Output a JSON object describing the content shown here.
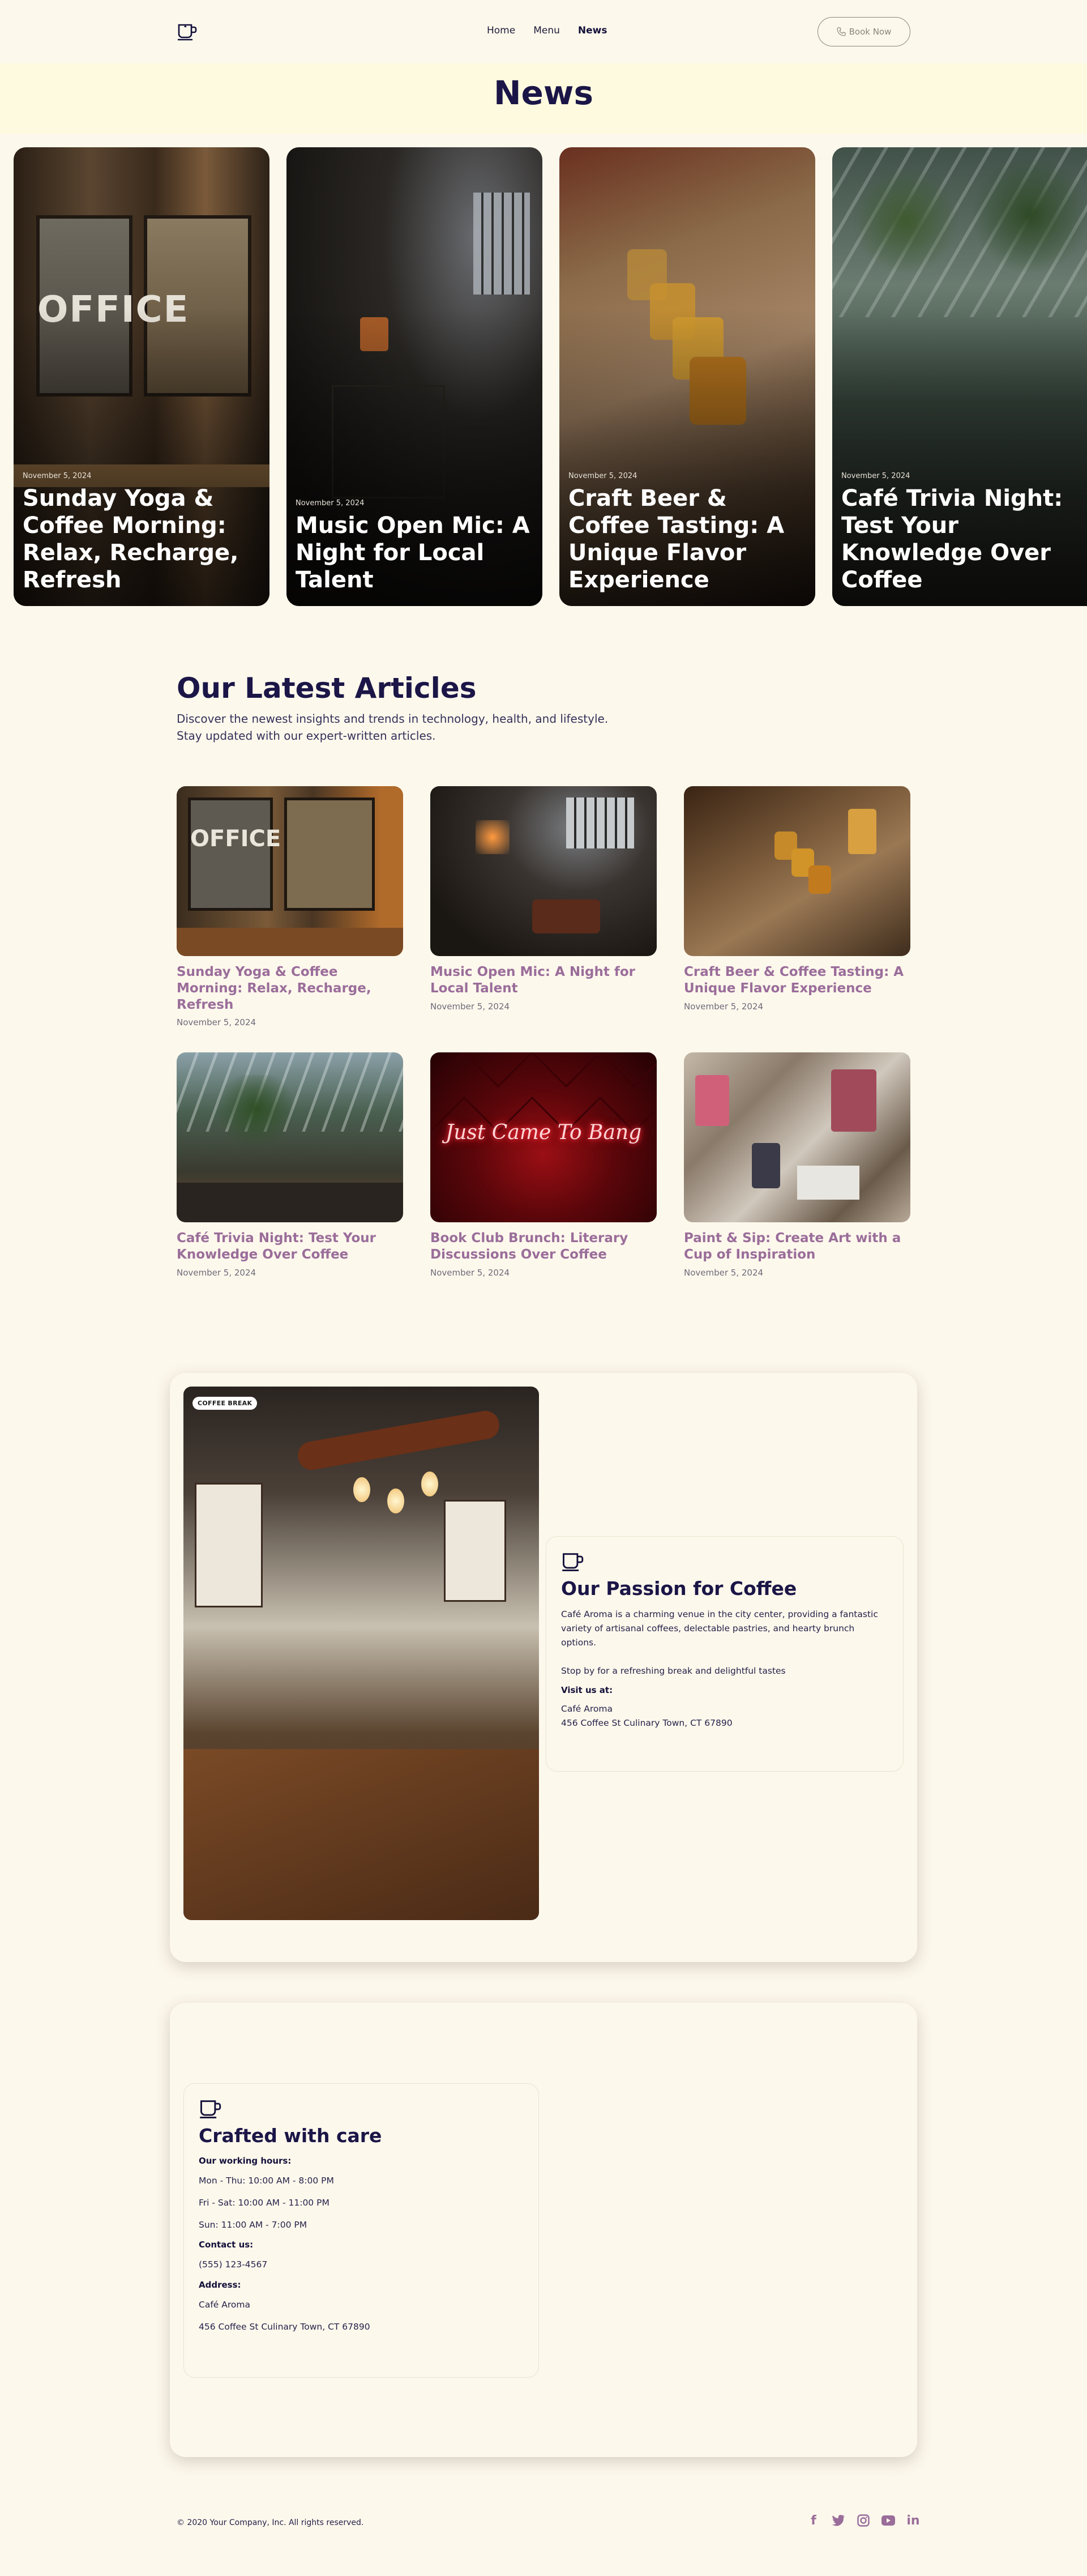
{
  "header": {
    "nav": [
      {
        "label": "Home"
      },
      {
        "label": "Menu"
      },
      {
        "label": "News"
      }
    ],
    "book_button": "Book Now",
    "logo_icon": "coffee-cup-icon"
  },
  "banner": {
    "title": "News"
  },
  "hero": [
    {
      "date": "November 5, 2024",
      "title": "Sunday Yoga & Coffee Morning: Relax, Recharge, Refresh"
    },
    {
      "date": "November 5, 2024",
      "title": "Music Open Mic: A Night for Local Talent"
    },
    {
      "date": "November 5, 2024",
      "title": "Craft Beer & Coffee Tasting: A Unique Flavor Experience"
    },
    {
      "date": "November 5, 2024",
      "title": "Café Trivia Night: Test Your Knowledge Over Coffee"
    }
  ],
  "latest": {
    "title": "Our Latest Articles",
    "subtitle": "Discover the newest insights and trends in technology, health, and lifestyle. Stay updated with our expert-written articles.",
    "articles": [
      {
        "title": "Sunday Yoga & Coffee Morning: Relax, Recharge, Refresh",
        "date": "November 5, 2024",
        "image_text": "OFFICE"
      },
      {
        "title": "Music Open Mic: A Night for Local Talent",
        "date": "November 5, 2024"
      },
      {
        "title": "Craft Beer & Coffee Tasting: A Unique Flavor Experience",
        "date": "November 5, 2024"
      },
      {
        "title": "Café Trivia Night: Test Your Knowledge Over Coffee",
        "date": "November 5, 2024"
      },
      {
        "title": "Book Club Brunch: Literary Discussions Over Coffee",
        "date": "November 5, 2024",
        "image_text": "Just Came To Bang"
      },
      {
        "title": "Paint & Sip: Create Art with a Cup of Inspiration",
        "date": "November 5, 2024"
      }
    ]
  },
  "about": {
    "badge": "COFFEE BREAK",
    "title": "Our Passion for Coffee",
    "description": "Café Aroma is a charming venue in the city center, providing a fantastic variety of artisanal coffees, delectable pastries, and hearty brunch options.",
    "tagline": "Stop by for a refreshing break and delightful tastes",
    "visit_label": "Visit us at:",
    "name": "Café Aroma",
    "address": "456 Coffee St Culinary Town, CT 67890"
  },
  "care": {
    "title": "Crafted with care",
    "hours_label": "Our working hours:",
    "hours": [
      "Mon - Thu: 10:00 AM - 8:00 PM",
      "Fri - Sat: 10:00 AM - 11:00 PM",
      "Sun: 11:00 AM - 7:00 PM"
    ],
    "contact_label": "Contact us:",
    "phone": "(555) 123-4567",
    "address_label": "Address:",
    "name": "Café Aroma",
    "address": "456 Coffee St Culinary Town, CT 67890"
  },
  "footer": {
    "copyright": "© 2020 Your Company, Inc. All rights reserved.",
    "social": [
      "facebook-icon",
      "twitter-icon",
      "instagram-icon",
      "youtube-icon",
      "linkedin-icon"
    ]
  },
  "colors": {
    "background": "#fdf8ec",
    "banner": "#fefadf",
    "heading": "#1b1647",
    "accent": "#9a6d9a"
  }
}
